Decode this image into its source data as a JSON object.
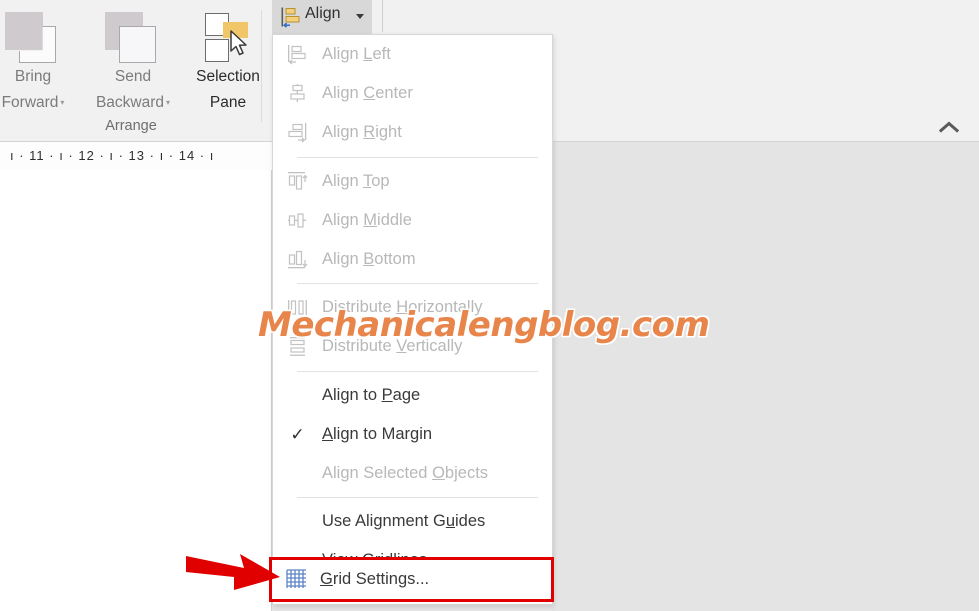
{
  "ribbon": {
    "group_title": "Arrange",
    "buttons": [
      {
        "line1": "Bring",
        "line2": "Forward",
        "has_caret": true,
        "icon": "bring-forward-icon"
      },
      {
        "line1": "Send",
        "line2": "Backward",
        "has_caret": true,
        "icon": "send-backward-icon"
      },
      {
        "line1": "Selection",
        "line2": "Pane",
        "has_caret": false,
        "icon": "selection-pane-icon"
      }
    ],
    "align_button": {
      "label": "Align",
      "icon": "align-left-icon",
      "caret": "chevron-down-icon"
    },
    "collapse_icon": "chevron-up-icon"
  },
  "ruler": {
    "text": "ı  · 11 ·  ı   · 12 ·  ı   · 13 ·  ı   · 14 ·  ı"
  },
  "menu": {
    "items": [
      {
        "label_pre": "Align ",
        "label_key": "L",
        "label_post": "eft",
        "icon": "align-left-icon",
        "disabled": true,
        "checked": false,
        "name": "menu-item-align-left"
      },
      {
        "label_pre": "Align ",
        "label_key": "C",
        "label_post": "enter",
        "icon": "align-center-icon",
        "disabled": true,
        "checked": false,
        "name": "menu-item-align-center"
      },
      {
        "label_pre": "Align ",
        "label_key": "R",
        "label_post": "ight",
        "icon": "align-right-icon",
        "disabled": true,
        "checked": false,
        "name": "menu-item-align-right"
      },
      {
        "separator": true
      },
      {
        "label_pre": "Align ",
        "label_key": "T",
        "label_post": "op",
        "icon": "align-top-icon",
        "disabled": true,
        "checked": false,
        "name": "menu-item-align-top"
      },
      {
        "label_pre": "Align ",
        "label_key": "M",
        "label_post": "iddle",
        "icon": "align-middle-icon",
        "disabled": true,
        "checked": false,
        "name": "menu-item-align-middle"
      },
      {
        "label_pre": "Align ",
        "label_key": "B",
        "label_post": "ottom",
        "icon": "align-bottom-icon",
        "disabled": true,
        "checked": false,
        "name": "menu-item-align-bottom"
      },
      {
        "separator": true
      },
      {
        "label_pre": "Distribute ",
        "label_key": "H",
        "label_post": "orizontally",
        "icon": "distribute-horizontal-icon",
        "disabled": true,
        "checked": false,
        "name": "menu-item-distribute-horizontally"
      },
      {
        "label_pre": "Distribute ",
        "label_key": "V",
        "label_post": "ertically",
        "icon": "distribute-vertical-icon",
        "disabled": true,
        "checked": false,
        "name": "menu-item-distribute-vertically"
      },
      {
        "separator": true
      },
      {
        "label_pre": "Align to ",
        "label_key": "P",
        "label_post": "age",
        "icon": "none",
        "disabled": false,
        "checked": false,
        "name": "menu-item-align-to-page"
      },
      {
        "label_pre": "",
        "label_key": "A",
        "label_post": "lign to Margin",
        "icon": "check-icon",
        "disabled": false,
        "checked": true,
        "name": "menu-item-align-to-margin"
      },
      {
        "label_pre": "Align Selected ",
        "label_key": "O",
        "label_post": "bjects",
        "icon": "none",
        "disabled": true,
        "checked": false,
        "name": "menu-item-align-selected-objects"
      },
      {
        "separator": true
      },
      {
        "label_pre": "Use Alignment G",
        "label_key": "u",
        "label_post": "ides",
        "icon": "none",
        "disabled": false,
        "checked": false,
        "name": "menu-item-use-alignment-guides"
      },
      {
        "label_pre": "View Gridline",
        "label_key": "s",
        "label_post": "",
        "icon": "none",
        "disabled": false,
        "checked": false,
        "name": "menu-item-view-gridlines"
      },
      {
        "separator": true
      }
    ],
    "highlighted_item": {
      "label_pre": "",
      "label_key": "G",
      "label_post": "rid Settings...",
      "icon": "grid-icon",
      "name": "menu-item-grid-settings",
      "highlight_color": "#e00000"
    }
  },
  "annotations": {
    "arrow": {
      "name": "red-arrow-pointer",
      "color": "#e00000"
    },
    "watermark": {
      "text": "Mechanicalengblog.com",
      "color": "#e8854a"
    }
  }
}
